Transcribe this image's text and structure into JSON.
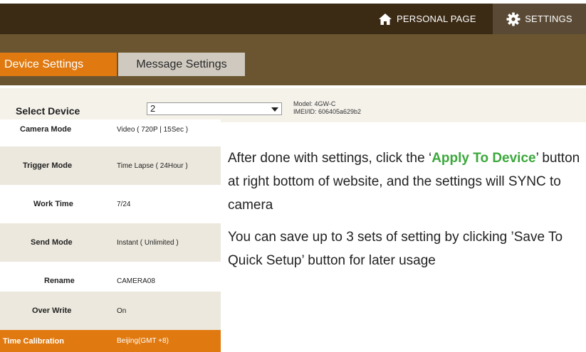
{
  "topbar": {
    "personal_label": "PERSONAL PAGE",
    "settings_label": "SETTINGS"
  },
  "tabs": {
    "device_settings": "Device Settings",
    "message_settings": "Message Settings"
  },
  "device_select": {
    "label": "Select Device",
    "value": "2",
    "model": "Model: 4GW-C",
    "imei": "IMEI/ID: 606405a629b2"
  },
  "settings_rows": [
    {
      "label": "Camera Mode",
      "value": "Video ( 720P | 15Sec )"
    },
    {
      "label": "Trigger Mode",
      "value": "Time Lapse ( 24Hour )"
    },
    {
      "label": "Work Time",
      "value": "7/24"
    },
    {
      "label": "Send Mode",
      "value": "Instant ( Unlimited )"
    },
    {
      "label": "Rename",
      "value": "CAMERA08"
    },
    {
      "label": "Over Write",
      "value": "On"
    },
    {
      "label": "Time Calibration",
      "value": "Beijing(GMT +8)"
    }
  ],
  "instructions": {
    "p1_before": "After done with settings, click the ‘",
    "p1_highlight": "Apply To Device",
    "p1_after": "’ button at right bottom of website, and the settings will SYNC to camera",
    "p2": "You can save up to 3 sets of setting by clicking ’Save To Quick Setup’ button for later usage"
  },
  "colors": {
    "topbar": "#3b2a14",
    "tabbar": "#6b5530",
    "accent_orange": "#e07a10",
    "highlight_green": "#3ca83c"
  }
}
